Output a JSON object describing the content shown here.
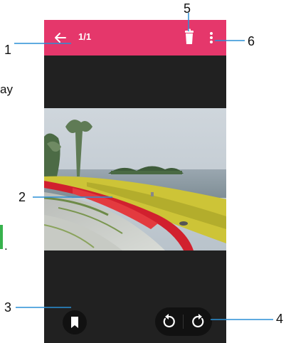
{
  "app": {
    "counter": "1/1"
  },
  "icons": {
    "back": "arrow-left-icon",
    "delete": "trash-icon",
    "more": "more-vert-icon",
    "bookmark": "bookmark-icon",
    "rotate_left": "rotate-left-icon",
    "rotate_right": "rotate-right-icon"
  },
  "colors": {
    "appbar": "#e5376b",
    "screen_bg": "#212121",
    "button_bg": "#111111"
  },
  "callouts": {
    "n1": "1",
    "n2": "2",
    "n3": "3",
    "n4": "4",
    "n5": "5",
    "n6": "6"
  },
  "side_text": {
    "left_top": "ay",
    "left_mid": "."
  }
}
